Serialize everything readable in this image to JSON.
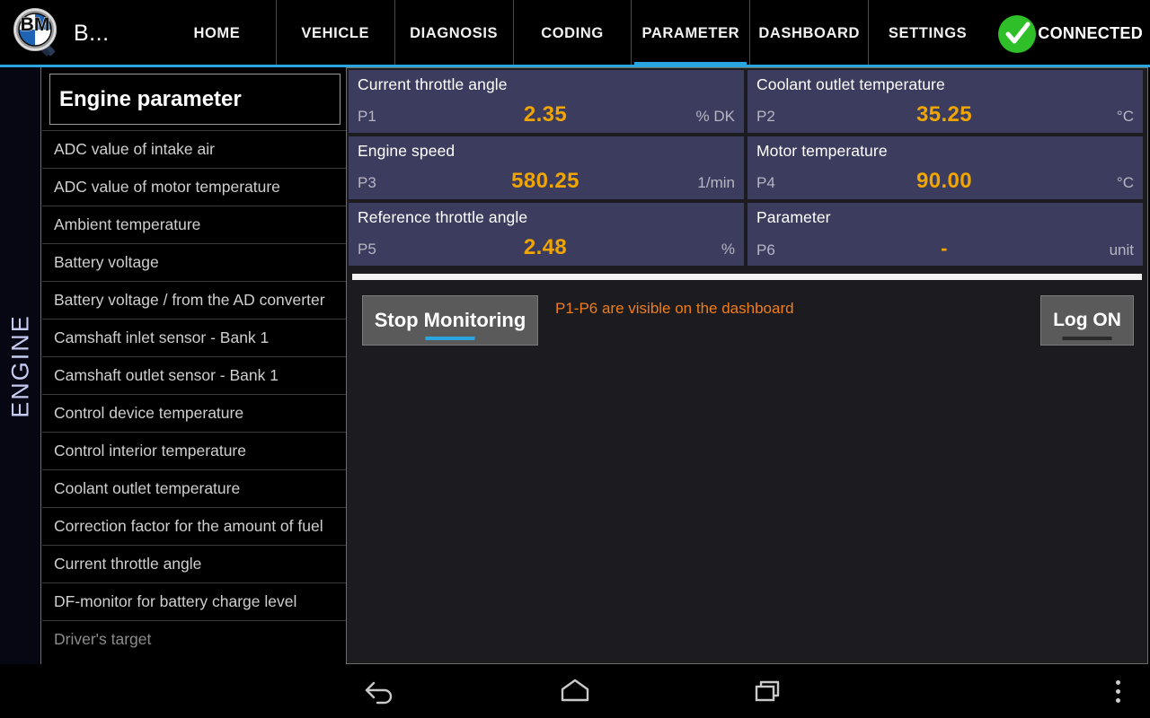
{
  "header": {
    "logo_icon": "bmw-magnifier-logo-icon",
    "app_title": "B...",
    "tabs": [
      {
        "label": "HOME",
        "active": false
      },
      {
        "label": "VEHICLE",
        "active": false
      },
      {
        "label": "DIAGNOSIS",
        "active": false
      },
      {
        "label": "CODING",
        "active": false
      },
      {
        "label": "PARAMETER",
        "active": true
      },
      {
        "label": "DASHBOARD",
        "active": false
      },
      {
        "label": "SETTINGS",
        "active": false
      }
    ],
    "connection": {
      "icon": "green-check-circle-icon",
      "label": "CONNECTED",
      "color": "#2fbf28"
    },
    "accent_color": "#2aa5e0"
  },
  "left_rail": {
    "label": "ENGINE"
  },
  "sidebar": {
    "header": "Engine parameter",
    "items": [
      {
        "label": "ADC value of intake air"
      },
      {
        "label": "ADC value of motor temperature"
      },
      {
        "label": "Ambient temperature"
      },
      {
        "label": "Battery voltage"
      },
      {
        "label": "Battery voltage / from the AD converter"
      },
      {
        "label": "Camshaft inlet sensor - Bank 1"
      },
      {
        "label": "Camshaft outlet sensor - Bank 1"
      },
      {
        "label": "Control device temperature"
      },
      {
        "label": "Control interior temperature"
      },
      {
        "label": "Coolant outlet temperature"
      },
      {
        "label": "Correction factor for the amount of fuel"
      },
      {
        "label": "Current throttle angle"
      },
      {
        "label": "DF-monitor for battery charge level"
      },
      {
        "label": "Driver's target"
      }
    ]
  },
  "main": {
    "cards": [
      {
        "title": "Current throttle angle",
        "id": "P1",
        "value": "2.35",
        "unit": "% DK"
      },
      {
        "title": "Coolant outlet temperature",
        "id": "P2",
        "value": "35.25",
        "unit": "°C"
      },
      {
        "title": "Engine speed",
        "id": "P3",
        "value": "580.25",
        "unit": "1/min"
      },
      {
        "title": "Motor temperature",
        "id": "P4",
        "value": "90.00",
        "unit": "°C"
      },
      {
        "title": "Reference throttle angle",
        "id": "P5",
        "value": "2.48",
        "unit": "%"
      },
      {
        "title": "Parameter",
        "id": "P6",
        "value": "-",
        "unit": "unit"
      }
    ],
    "value_color": "#f0a500",
    "card_color": "#3c3c5e",
    "stop_button": "Stop Monitoring",
    "log_button": "Log ON",
    "hint": "P1-P6 are visible on the dashboard",
    "hint_color": "#f07d18"
  },
  "navbar": {
    "back_icon": "back-arrow-icon",
    "home_icon": "home-icon",
    "recent_icon": "recent-apps-icon",
    "menu_icon": "overflow-menu-icon"
  }
}
